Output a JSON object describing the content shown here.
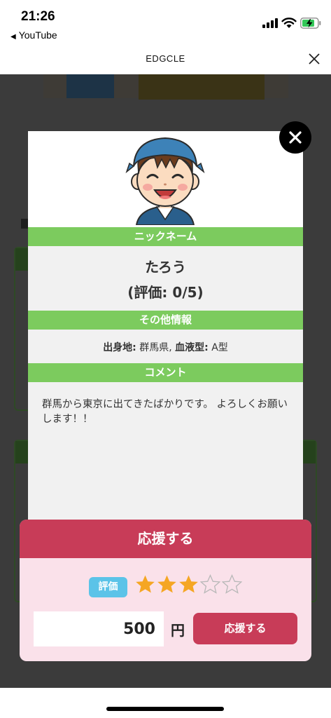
{
  "status_bar": {
    "time": "21:26",
    "back_app": "YouTube",
    "back_arrow": "◀"
  },
  "header": {
    "title": "EDGCLE"
  },
  "profile": {
    "nickname_header": "ニックネーム",
    "nickname": "たろう",
    "rating_text": "(評価: 0/5)",
    "other_info_header": "その他情報",
    "birthplace_label": "出身地:",
    "birthplace_value": "群馬県,",
    "blood_type_label": "血液型:",
    "blood_type_value": "A型",
    "comment_header": "コメント",
    "comment": "群馬から東京に出てきたばかりです。 よろしくお願いします！！"
  },
  "support": {
    "header": "応援する",
    "rating_label": "評価",
    "rating_value": 3,
    "rating_max": 5,
    "amount_value": "500",
    "currency": "円",
    "button_label": "応援する"
  },
  "colors": {
    "green_section": "#7ccb5e",
    "crimson": "#c83c58",
    "panel_pink": "#fae1ea",
    "badge_blue": "#5bc3e8",
    "star_gold": "#f5a623",
    "overlay": "#3b3b3b"
  },
  "icons": {
    "signal": "signal-icon",
    "wifi": "wifi-icon",
    "battery": "battery-icon",
    "header_close": "close-icon",
    "modal_close": "close-circle-icon",
    "avatar": "avatar-boy-icon",
    "star": "star-icon"
  }
}
